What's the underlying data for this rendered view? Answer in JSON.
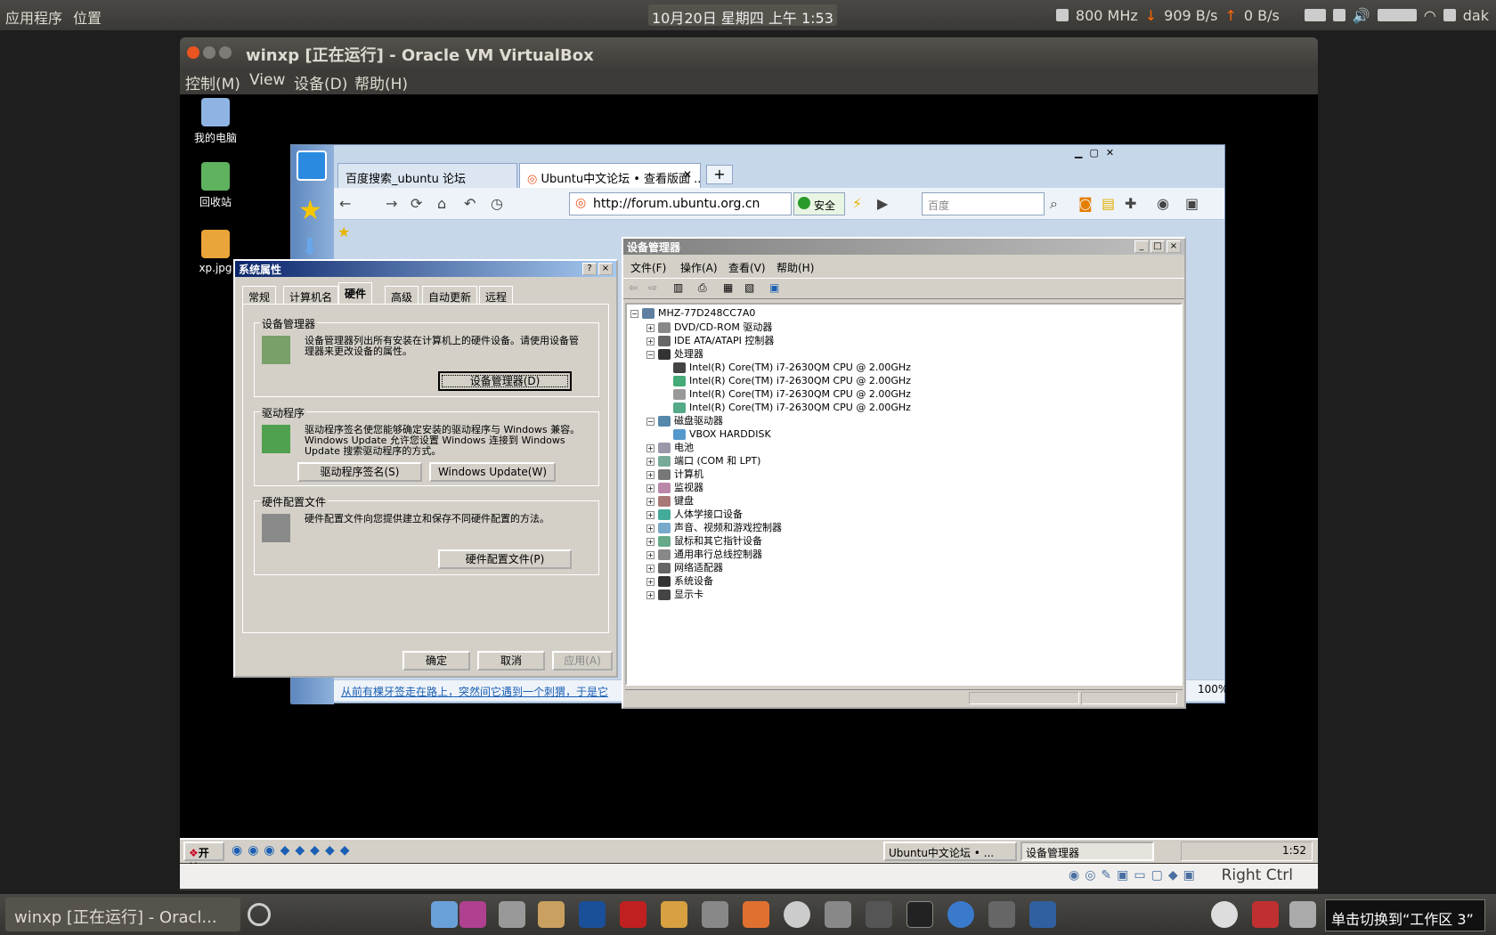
{
  "top_panel": {
    "menu_apps": "应用程序",
    "menu_places": "位置",
    "clock": "10月20日 星期四 上午 1:53",
    "cpu_freq": "800 MHz",
    "net_down": "909 B/s",
    "net_up": "0 B/s",
    "user": "dak"
  },
  "vbox": {
    "title": "winxp [正在运行] - Oracle VM VirtualBox",
    "menu": [
      "控制(M)",
      "View",
      "设备(D)",
      "帮助(H)"
    ],
    "status_host_key": "Right Ctrl"
  },
  "desktop": {
    "icons": [
      "我的电脑",
      "回收站",
      "xp.jpg"
    ]
  },
  "browser": {
    "tabs": [
      "百度搜索_ubuntu 论坛",
      "Ubuntu中文论坛 • 查看版面 ..."
    ],
    "new_tab": "+",
    "url": "http://forum.ubuntu.org.cn",
    "safe_label": "安全",
    "search_placeholder": "百度",
    "status_link": "从前有棵牙签走在路上，突然间它遇到一个刺猬，于是它",
    "zoom": "100%"
  },
  "sysprop": {
    "title": "系统属性",
    "tabs": [
      "常规",
      "计算机名",
      "硬件",
      "高级",
      "自动更新",
      "远程"
    ],
    "active_tab": "硬件",
    "dm_group": "设备管理器",
    "dm_text": "设备管理器列出所有安装在计算机上的硬件设备。请使用设备管理器来更改设备的属性。",
    "dm_button": "设备管理器(D)",
    "drv_group": "驱动程序",
    "drv_text": "驱动程序签名使您能够确定安装的驱动程序与 Windows 兼容。Windows Update 允许您设置 Windows 连接到 Windows Update 搜索驱动程序的方式。",
    "drv_button1": "驱动程序签名(S)",
    "drv_button2": "Windows Update(W)",
    "hw_group": "硬件配置文件",
    "hw_text": "硬件配置文件向您提供建立和保存不同硬件配置的方法。",
    "hw_button": "硬件配置文件(P)",
    "ok": "确定",
    "cancel": "取消",
    "apply": "应用(A)",
    "help_btn": "?",
    "close_btn": "×"
  },
  "devmgr": {
    "title": "设备管理器",
    "menu": [
      "文件(F)",
      "操作(A)",
      "查看(V)",
      "帮助(H)"
    ],
    "root": "MHZ-77D248CC7A0",
    "nodes": [
      {
        "label": "DVD/CD-ROM 驱动器",
        "level": 1,
        "expanded": false
      },
      {
        "label": "IDE ATA/ATAPI 控制器",
        "level": 1,
        "expanded": false
      },
      {
        "label": "处理器",
        "level": 1,
        "expanded": true
      },
      {
        "label": "Intel(R) Core(TM) i7-2630QM CPU @ 2.00GHz",
        "level": 2
      },
      {
        "label": "Intel(R) Core(TM) i7-2630QM CPU @ 2.00GHz",
        "level": 2
      },
      {
        "label": "Intel(R) Core(TM) i7-2630QM CPU @ 2.00GHz",
        "level": 2
      },
      {
        "label": "Intel(R) Core(TM) i7-2630QM CPU @ 2.00GHz",
        "level": 2
      },
      {
        "label": "磁盘驱动器",
        "level": 1,
        "expanded": true
      },
      {
        "label": "VBOX HARDDISK",
        "level": 2
      },
      {
        "label": "电池",
        "level": 1,
        "expanded": false
      },
      {
        "label": "端口 (COM 和 LPT)",
        "level": 1,
        "expanded": false
      },
      {
        "label": "计算机",
        "level": 1,
        "expanded": false
      },
      {
        "label": "监视器",
        "level": 1,
        "expanded": false
      },
      {
        "label": "键盘",
        "level": 1,
        "expanded": false
      },
      {
        "label": "人体学接口设备",
        "level": 1,
        "expanded": false
      },
      {
        "label": "声音、视频和游戏控制器",
        "level": 1,
        "expanded": false
      },
      {
        "label": "鼠标和其它指针设备",
        "level": 1,
        "expanded": false
      },
      {
        "label": "通用串行总线控制器",
        "level": 1,
        "expanded": false
      },
      {
        "label": "网络适配器",
        "level": 1,
        "expanded": false
      },
      {
        "label": "系统设备",
        "level": 1,
        "expanded": false
      },
      {
        "label": "显示卡",
        "level": 1,
        "expanded": false
      }
    ]
  },
  "xp_taskbar": {
    "start": "开始",
    "tasks": [
      "Ubuntu中文论坛 • ...",
      "设备管理器"
    ],
    "clock": "1:52"
  },
  "bottom_panel": {
    "task": "winxp [正在运行] - Oracl...",
    "workspace_tooltip": "单击切换到“工作区 3”"
  },
  "colors": {
    "panel": "#3c3b37",
    "xp_title": "#0a246a",
    "classic_face": "#d4d0c8"
  }
}
